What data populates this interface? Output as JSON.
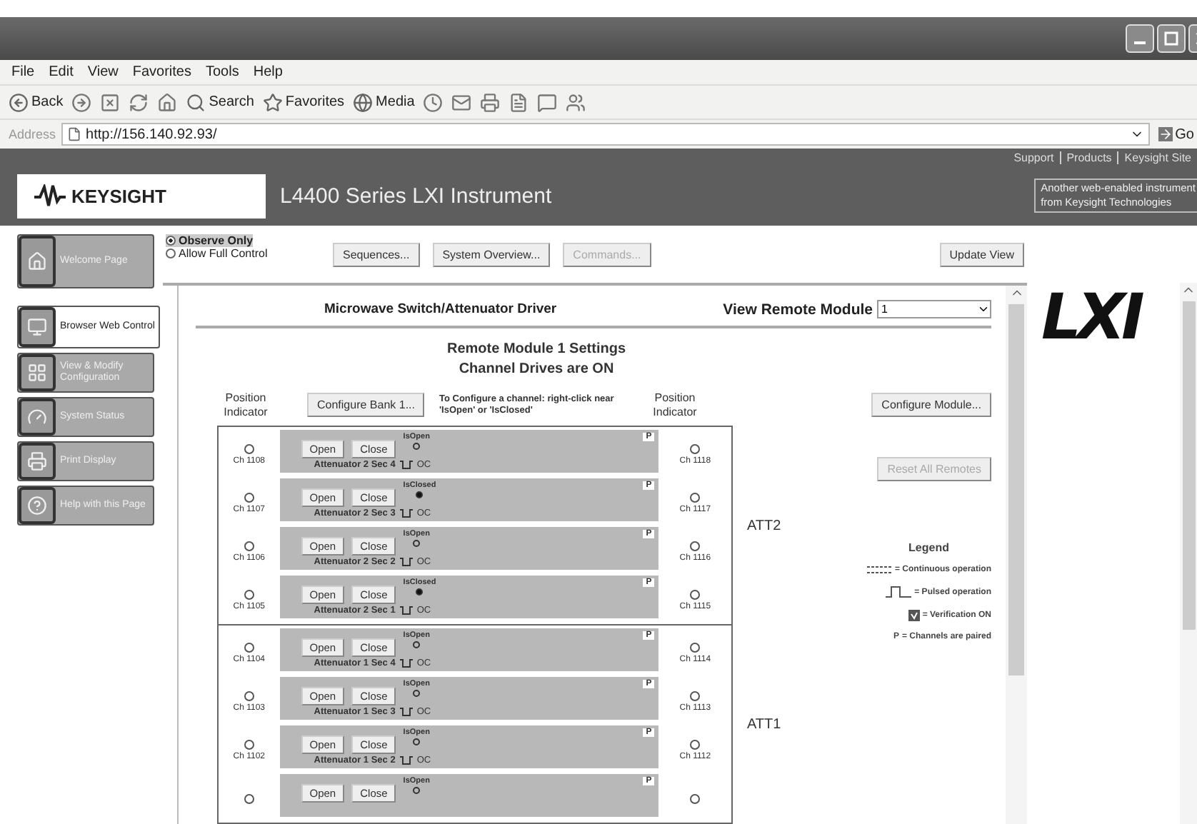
{
  "menu": [
    "File",
    "Edit",
    "View",
    "Favorites",
    "Tools",
    "Help"
  ],
  "toolbar": [
    {
      "kind": "back",
      "label": "Back"
    },
    {
      "kind": "forward"
    },
    {
      "kind": "stop"
    },
    {
      "kind": "refresh"
    },
    {
      "kind": "home"
    },
    {
      "kind": "search",
      "label": "Search"
    },
    {
      "kind": "favorites",
      "label": "Favorites"
    },
    {
      "kind": "media",
      "label": "Media"
    },
    {
      "kind": "history"
    },
    {
      "kind": "mail"
    },
    {
      "kind": "print"
    },
    {
      "kind": "edit"
    },
    {
      "kind": "discuss"
    },
    {
      "kind": "messenger"
    }
  ],
  "address": {
    "label": "Address",
    "url": "http://156.140.92.93/",
    "go": "Go"
  },
  "site_header": {
    "links": [
      "Support",
      "Products",
      "Keysight Site"
    ],
    "logo": "KEYSIGHT",
    "title": "L4400 Series LXI Instrument",
    "tagline": [
      "Another web-enabled instrument",
      "from Keysight Technologies"
    ]
  },
  "nav": [
    {
      "kind": "home",
      "label": "Welcome Page",
      "selected": false
    },
    {
      "kind": "browser",
      "label": "Browser Web Control",
      "selected": true
    },
    {
      "kind": "config",
      "label": "View & Modify Configuration",
      "selected": false
    },
    {
      "kind": "status",
      "label": "System Status",
      "selected": false
    },
    {
      "kind": "print",
      "label": "Print Display",
      "selected": false
    },
    {
      "kind": "help",
      "label": "Help with this Page",
      "selected": false
    }
  ],
  "mode": [
    {
      "label": "Observe Only",
      "selected": true
    },
    {
      "label": "Allow Full Control",
      "selected": false
    }
  ],
  "actions": [
    {
      "label": "Sequences...",
      "disabled": false
    },
    {
      "label": "System Overview...",
      "disabled": false
    },
    {
      "label": "Commands...",
      "disabled": true
    }
  ],
  "update_button": "Update View",
  "lxi_logo": "LXI",
  "panel": {
    "title": "Microwave Switch/Attenuator Driver",
    "module_label": "View Remote Module",
    "module_value": "1",
    "settings_title": "Remote Module 1 Settings",
    "drive_status": "Channel Drives are ON",
    "position_left": "Position Indicator",
    "configure_bank": "Configure Bank 1...",
    "instructions": "To Configure a channel: right-click near 'IsOpen' or 'IsClosed'",
    "position_right": "Position Indicator",
    "configure_module": "Configure Module...",
    "reset": {
      "label": "Reset All Remotes",
      "disabled": true
    },
    "groups": [
      {
        "label": "ATT2",
        "channels": [
          {
            "left": "Ch 1108",
            "right": "Ch 1118",
            "open": "Open",
            "close": "Close",
            "state": "IsOpen",
            "closed": false,
            "name": "Attenuator 2 Sec 4",
            "kind": "pulsed",
            "mode": "OC",
            "paired": "P"
          },
          {
            "left": "Ch 1107",
            "right": "Ch 1117",
            "open": "Open",
            "close": "Close",
            "state": "IsClosed",
            "closed": true,
            "name": "Attenuator 2 Sec 3",
            "kind": "pulsed",
            "mode": "OC",
            "paired": "P"
          },
          {
            "left": "Ch 1106",
            "right": "Ch 1116",
            "open": "Open",
            "close": "Close",
            "state": "IsOpen",
            "closed": false,
            "name": "Attenuator 2 Sec 2",
            "kind": "pulsed",
            "mode": "OC",
            "paired": "P"
          },
          {
            "left": "Ch 1105",
            "right": "Ch 1115",
            "open": "Open",
            "close": "Close",
            "state": "IsClosed",
            "closed": true,
            "name": "Attenuator 2 Sec 1",
            "kind": "pulsed",
            "mode": "OC",
            "paired": "P"
          }
        ]
      },
      {
        "label": "ATT1",
        "channels": [
          {
            "left": "Ch 1104",
            "right": "Ch 1114",
            "open": "Open",
            "close": "Close",
            "state": "IsOpen",
            "closed": false,
            "name": "Attenuator 1 Sec 4",
            "kind": "pulsed",
            "mode": "OC",
            "paired": "P"
          },
          {
            "left": "Ch 1103",
            "right": "Ch 1113",
            "open": "Open",
            "close": "Close",
            "state": "IsOpen",
            "closed": false,
            "name": "Attenuator 1 Sec 3",
            "kind": "pulsed",
            "mode": "OC",
            "paired": "P"
          },
          {
            "left": "Ch 1102",
            "right": "Ch 1112",
            "open": "Open",
            "close": "Close",
            "state": "IsOpen",
            "closed": false,
            "name": "Attenuator 1 Sec 2",
            "kind": "pulsed",
            "mode": "OC",
            "paired": "P"
          },
          {
            "open": "Open",
            "close": "Close",
            "state": "IsOpen",
            "closed": false,
            "paired": "P"
          }
        ]
      }
    ],
    "legend": {
      "title": "Legend",
      "items": [
        {
          "kind": "continuous",
          "text": "= Continuous operation"
        },
        {
          "kind": "pulsed",
          "text": "= Pulsed operation"
        },
        {
          "kind": "verification",
          "text": "= Verification ON"
        },
        {
          "kind": "paired",
          "symbol": "P",
          "text": "= Channels are paired"
        }
      ]
    }
  }
}
